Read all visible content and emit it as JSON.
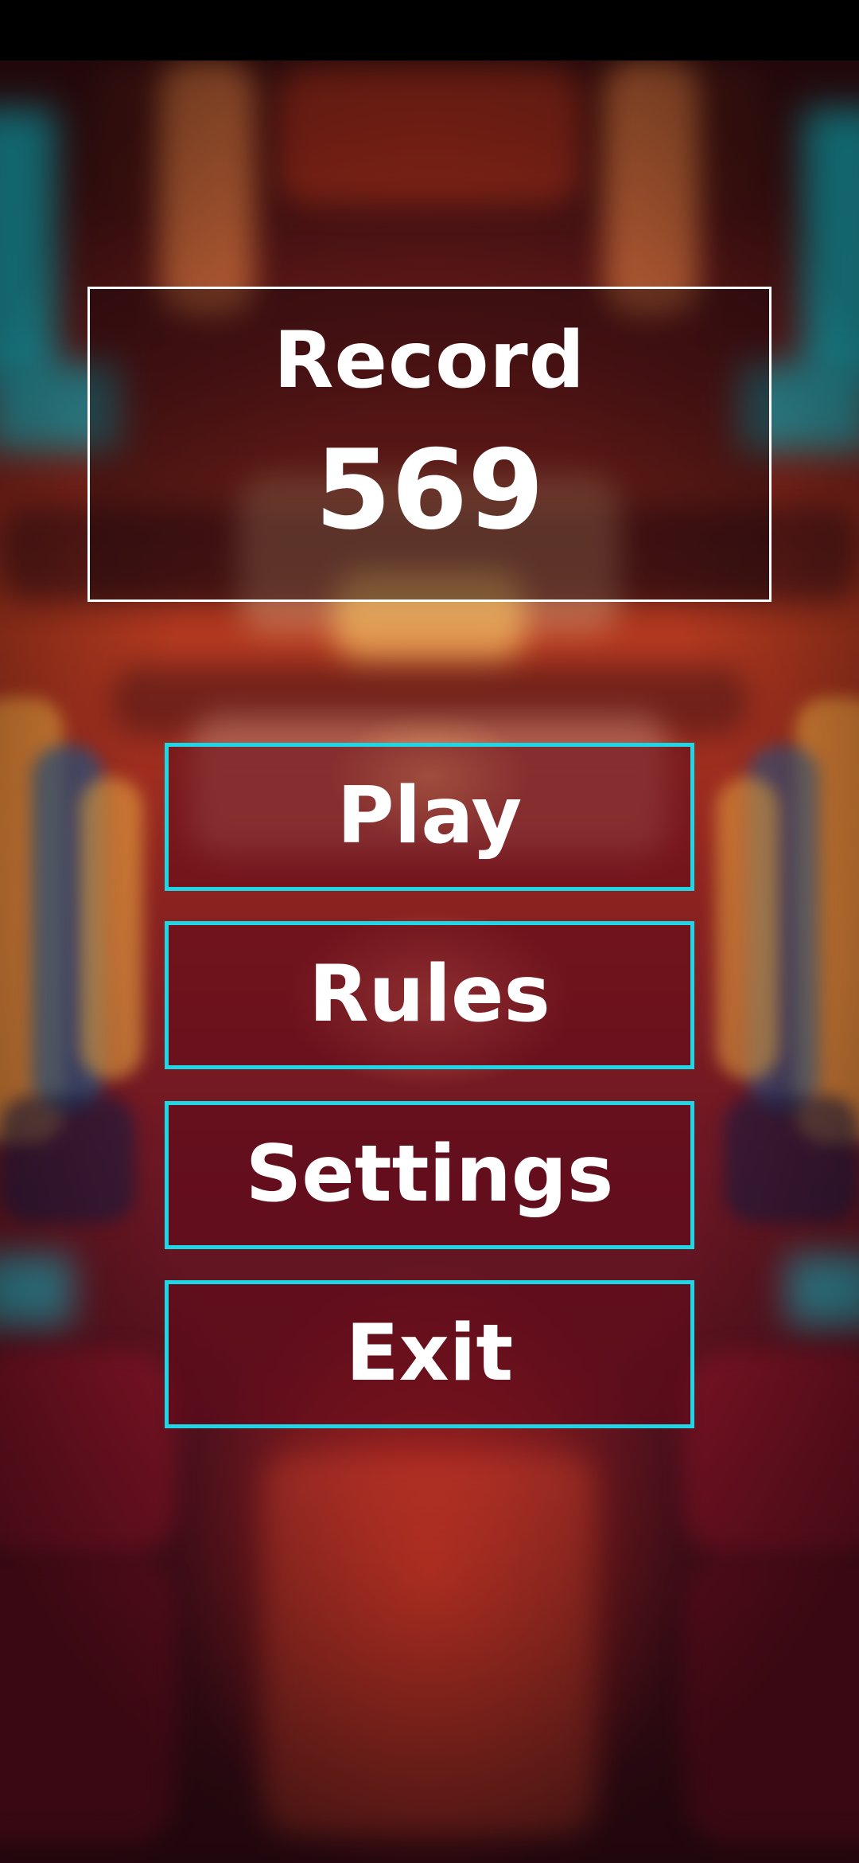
{
  "record": {
    "title": "Record",
    "value": "569"
  },
  "menu": {
    "play_label": "Play",
    "rules_label": "Rules",
    "settings_label": "Settings",
    "exit_label": "Exit"
  },
  "colors": {
    "button_border": "#1ed6e6",
    "panel_border": "#ffffff",
    "text": "#ffffff",
    "status_bar": "#000000"
  }
}
